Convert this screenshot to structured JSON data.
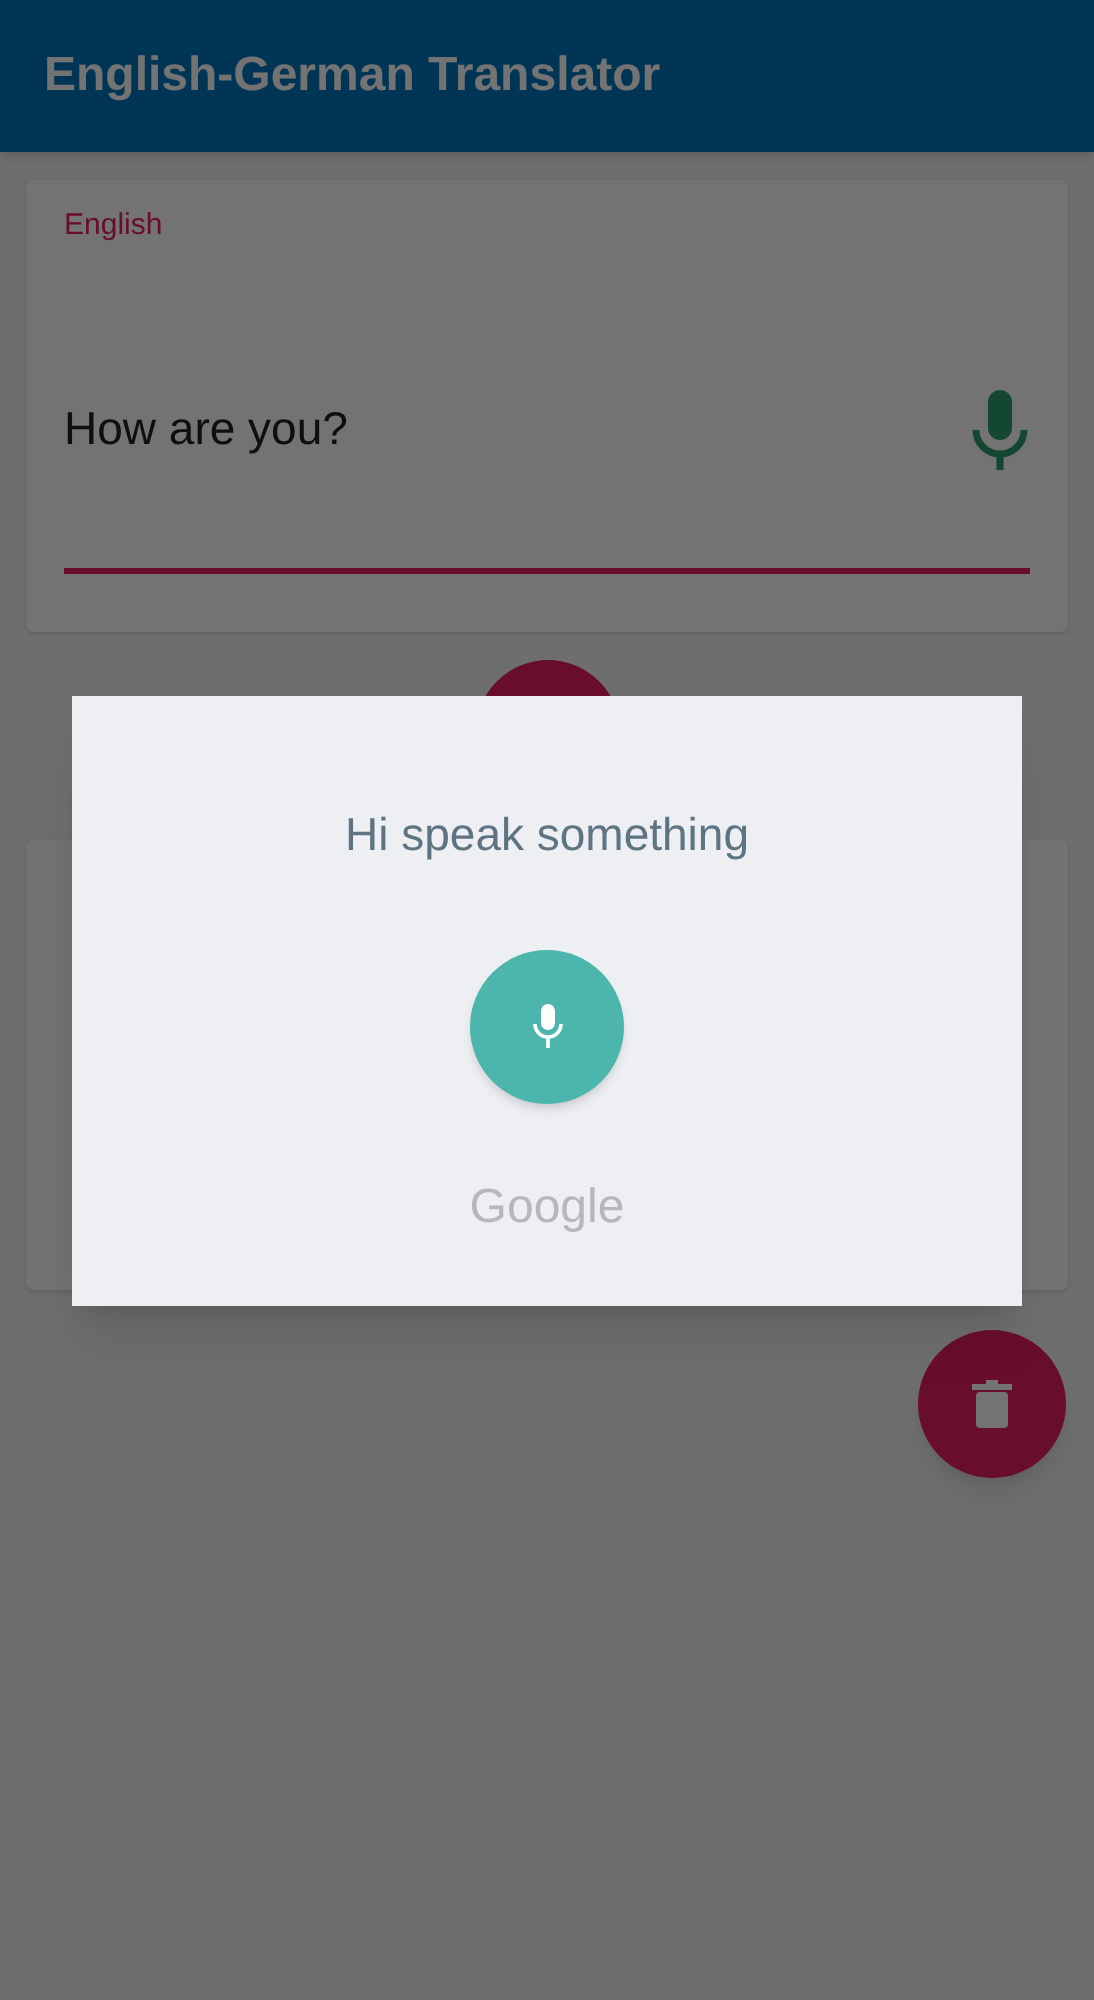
{
  "app_bar": {
    "title": "English-German Translator"
  },
  "source_card": {
    "label": "English",
    "value": "How are you?"
  },
  "dialog": {
    "prompt": "Hi speak something",
    "brand": "Google"
  }
}
